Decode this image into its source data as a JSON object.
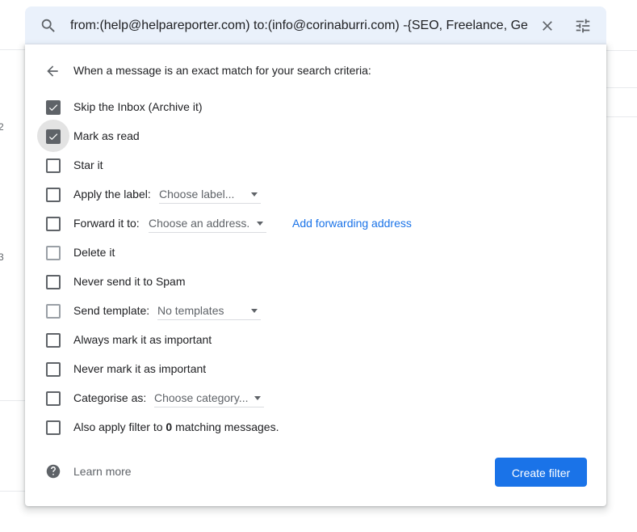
{
  "search": {
    "query": "from:(help@helpareporter.com) to:(info@corinaburri.com) -{SEO, Freelance, Ge"
  },
  "dialog": {
    "heading": "When a message is an exact match for your search criteria:",
    "options": [
      {
        "label": "Skip the Inbox (Archive it)",
        "checked": true
      },
      {
        "label": "Mark as read",
        "checked": true
      },
      {
        "label": "Star it",
        "checked": false
      },
      {
        "label": "Apply the label:",
        "checked": false,
        "dropdown": "Choose label..."
      },
      {
        "label": "Forward it to:",
        "checked": false,
        "dropdown": "Choose an address.",
        "link": "Add forwarding address"
      },
      {
        "label": "Delete it",
        "checked": false
      },
      {
        "label": "Never send it to Spam",
        "checked": false
      },
      {
        "label": "Send template:",
        "checked": false,
        "dropdown": "No templates"
      },
      {
        "label": "Always mark it as important",
        "checked": false
      },
      {
        "label": "Never mark it as important",
        "checked": false
      },
      {
        "label": "Categorise as:",
        "checked": false,
        "dropdown": "Choose category..."
      },
      {
        "label_before": "Also apply filter to",
        "count": "0",
        "label_after": "matching messages.",
        "checked": false
      }
    ],
    "learn_more": "Learn more",
    "create_button": "Create filter"
  },
  "background": {
    "glyph_1": "2",
    "glyph_2": "3"
  },
  "colors": {
    "accent": "#1a73e8",
    "search_bg": "#eaf1fb",
    "checkbox": "#5f6368"
  },
  "icons": [
    "search-icon",
    "close-icon",
    "tune-icon",
    "arrow-back-icon",
    "checkmark-icon",
    "dropdown-arrow-icon",
    "help-icon"
  ]
}
